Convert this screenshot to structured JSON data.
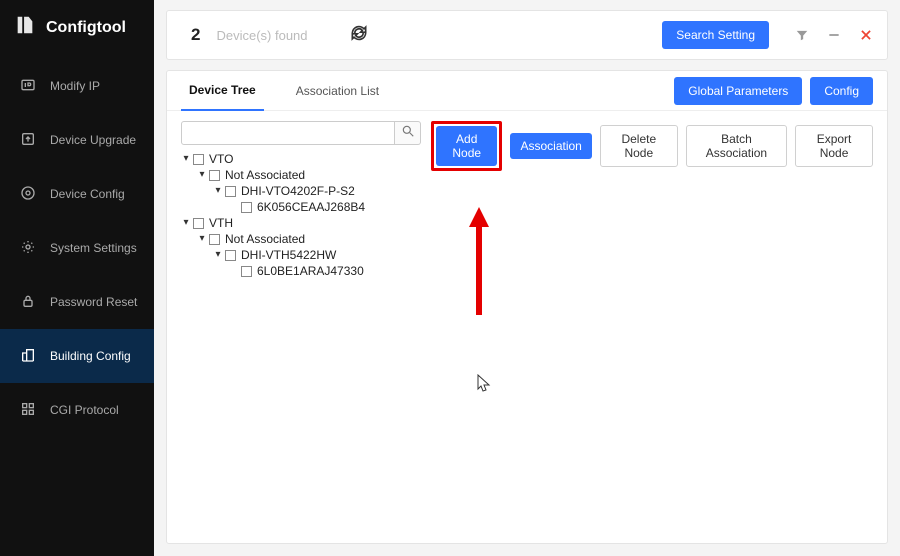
{
  "brand": "Configtool",
  "sidebar": {
    "items": [
      {
        "label": "Modify IP"
      },
      {
        "label": "Device Upgrade"
      },
      {
        "label": "Device Config"
      },
      {
        "label": "System Settings"
      },
      {
        "label": "Password Reset"
      },
      {
        "label": "Building Config"
      },
      {
        "label": "CGI Protocol"
      }
    ]
  },
  "topbar": {
    "count": "2",
    "found_label": "Device(s) found",
    "search_setting": "Search Setting"
  },
  "tabs": {
    "device_tree": "Device Tree",
    "association_list": "Association List",
    "global_parameters": "Global Parameters",
    "config": "Config"
  },
  "actions": {
    "add_node": "Add Node",
    "association": "Association",
    "delete_node": "Delete Node",
    "batch_association": "Batch Association",
    "export_node": "Export Node"
  },
  "tree": {
    "vto": "VTO",
    "vto_na": "Not Associated",
    "vto_dev": "DHI-VTO4202F-P-S2",
    "vto_sn": "6K056CEAAJ268B4",
    "vth": "VTH",
    "vth_na": "Not Associated",
    "vth_dev": "DHI-VTH5422HW",
    "vth_sn": "6L0BE1ARAJ47330"
  },
  "search": {
    "placeholder": ""
  }
}
